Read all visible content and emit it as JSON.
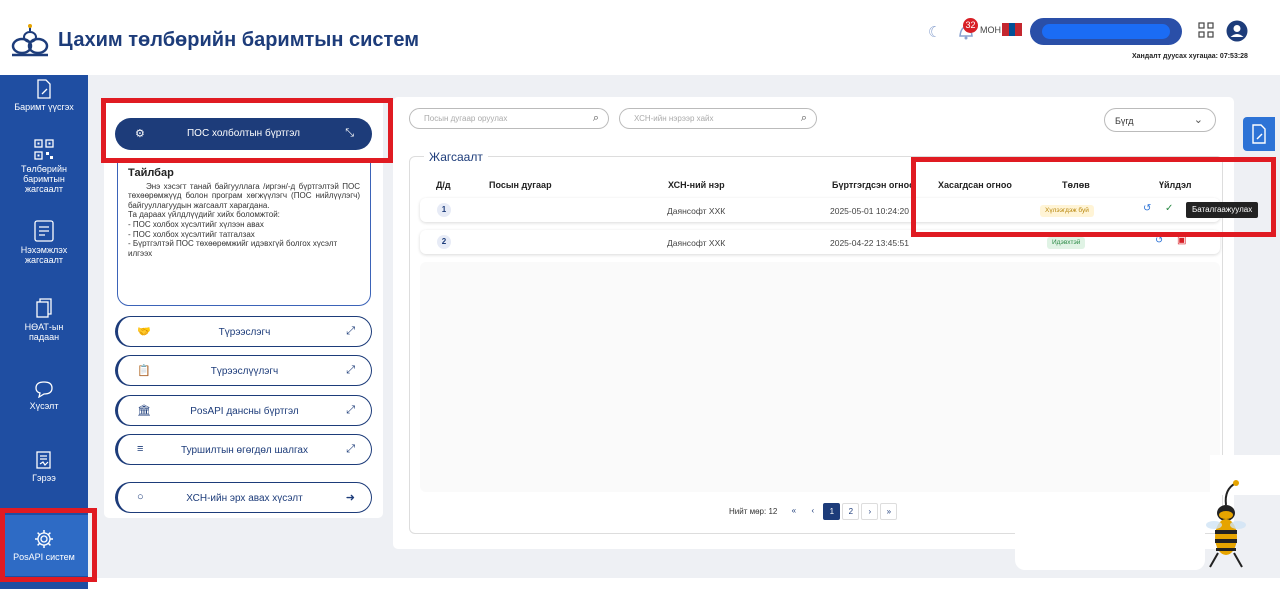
{
  "header": {
    "title": "Цахим төлбөрийн баримтын систем",
    "notif_count": "32",
    "lang": "MOH",
    "session_label": "Хандалт дуусах хугацаа: 07:53:28"
  },
  "sidebar": {
    "items": [
      {
        "label": "Баримт үүсгэх",
        "icon": "document-edit-icon"
      },
      {
        "label": "Төлбөрийн баримтын жагсаалт",
        "icon": "qr-code-icon"
      },
      {
        "label": "Нэхэмжлэх жагсаалт",
        "icon": "invoice-icon"
      },
      {
        "label": "НӨАТ-ын падаан",
        "icon": "copy-icon"
      },
      {
        "label": "Хүсэлт",
        "icon": "chat-icon"
      },
      {
        "label": "Гэрээ",
        "icon": "contract-icon"
      },
      {
        "label": "PosAPI систем",
        "icon": "gear-icon"
      }
    ]
  },
  "left_panel": {
    "main_button": "ПОС холболтын бүртгэл",
    "info": {
      "title": "Тайлбар",
      "paragraph": "Энэ хэсэгт танай байгууллага /иргэн/-д бүртгэлтэй ПОС төхөөрөмжүүд болон програм хөгжүүлэгч (ПОС нийлүүлэгч) байгууллагуудын жагсаалт харагдана.",
      "line1": "Та дараах үйлдлүүдийг хийх боломжтой:",
      "line2": "- ПОС холбох хүсэлтийг хүлээн авах",
      "line3": "- ПОС холбох хүсэлтийг татгалзах",
      "line4": "- Бүртгэлтэй ПОС төхөөрөмжийг идэвхгүй болгох хүсэлт илгээх"
    },
    "menu": [
      {
        "label": "Түрээслэгч",
        "icon": "handshake-icon"
      },
      {
        "label": "Түрээслүүлэгч",
        "icon": "clipboard-icon"
      },
      {
        "label": "PosAPI дансны бүртгэл",
        "icon": "bank-icon"
      },
      {
        "label": "Туршилтын өгөгдөл шалгах",
        "icon": "database-icon"
      },
      {
        "label": "ХСН-ийн эрх авах хүсэлт",
        "icon": "chat-icon"
      }
    ]
  },
  "filters": {
    "pos_placeholder": "Посын дугаар оруулах",
    "company_placeholder": "ХСН-ийн нэрээр хайх",
    "status_value": "Бүгд"
  },
  "table": {
    "section_title": "Жагсаалт",
    "columns": [
      "Д/д",
      "Посын дугаар",
      "ХСН-ний нэр",
      "Бүртгэгдсэн огноо",
      "Хасагдсан огноо",
      "Төлөв",
      "Үйлдэл"
    ],
    "rows": [
      {
        "no": "1",
        "pos": "",
        "company": "Даянсофт ХХК",
        "registered": "2025-05-01 10:24:20",
        "removed": "",
        "status": "Хүлээгдэж буй",
        "status_color": "#b8860b"
      },
      {
        "no": "2",
        "pos": "",
        "company": "Даянсофт ХХК",
        "registered": "2025-04-22 13:45:51",
        "removed": "",
        "status": "Идэвхтэй",
        "status_color": "#2c8b46"
      }
    ],
    "tooltip": "Баталгаажуулах"
  },
  "pagination": {
    "total": "Нийт мөр: 12",
    "first": "«",
    "prev": "‹",
    "pages": [
      "1",
      "2"
    ],
    "next": "›",
    "last": "»"
  },
  "colors": {
    "brand": "#1d3c7a",
    "sidebar": "#1f4ea2",
    "highlight": "#e01b22"
  }
}
